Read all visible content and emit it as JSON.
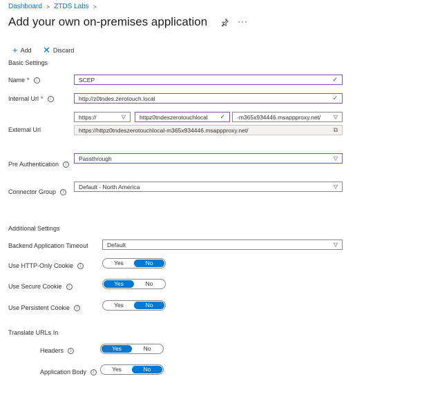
{
  "breadcrumb": {
    "items": [
      "Dashboard",
      "ZTDS Labs"
    ]
  },
  "page": {
    "title": "Add your own on-premises application",
    "pin_icon": "pin-icon",
    "more": "···"
  },
  "toolbar": {
    "add_label": "Add",
    "discard_label": "Discard"
  },
  "basic": {
    "heading": "Basic Settings",
    "name_label": "Name",
    "name_value": "SCEP",
    "internal_url_label": "Internal Url",
    "internal_url_value": "http://z0tndes.zerotouch.local",
    "external_url_label": "External Url",
    "external_scheme": "https://",
    "external_host": "httpz0tndeszerotouchlocal",
    "external_suffix": "-m365x934446.msappproxy.net/",
    "external_full": "https://httpz0tndeszerotouchlocal-m365x934446.msappproxy.net/",
    "preauth_label": "Pre Authentication",
    "preauth_value": "Passthrough",
    "connector_label": "Connector Group",
    "connector_value": "Default - North America",
    "required_mark": "*"
  },
  "additional": {
    "heading": "Additional Settings",
    "timeout_label": "Backend Application Timeout",
    "timeout_value": "Default",
    "http_only_label": "Use HTTP-Only Cookie",
    "secure_label": "Use Secure Cookie",
    "persistent_label": "Use Persistent Cookie",
    "translate_heading": "Translate URLs In",
    "headers_label": "Headers",
    "body_label": "Application Body",
    "yes": "Yes",
    "no": "No"
  },
  "toggles": {
    "http_only": "No",
    "secure": "Yes",
    "persistent": "No",
    "headers": "Yes",
    "body": "No"
  },
  "colors": {
    "accent": "#0078d4",
    "active_border": "#8a4fb5",
    "valid": "#107c10"
  }
}
